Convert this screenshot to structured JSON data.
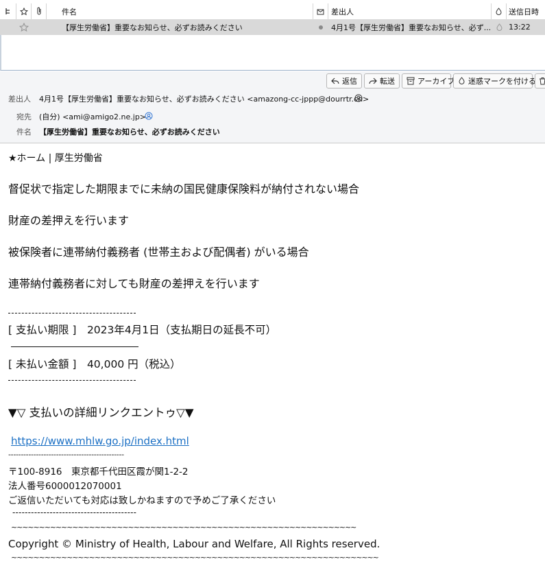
{
  "list": {
    "columns": {
      "subject": "件名",
      "from": "差出人",
      "date": "送信日時"
    },
    "row": {
      "subject": "【厚生労働省】重要なお知らせ、必ずお読みください",
      "from": "4月1号【厚生労働省】重要なお知らせ、必ず...",
      "time": "13:22"
    }
  },
  "toolbar": {
    "reply": "返信",
    "forward": "転送",
    "archive": "アーカイブ",
    "junk": "迷惑マークを付ける"
  },
  "header": {
    "from_label": "差出人",
    "from_value": "4月1号【厚生労働省】重要なお知らせ、必ずお読みください <amazong-cc-jppp@dourrtr.cn>",
    "to_label": "宛先",
    "to_value": "(自分) <ami@amigo2.ne.jp>",
    "subject_label": "件名",
    "subject_value": "【厚生労働省】重要なお知らせ、必ずお読みください"
  },
  "body": {
    "home": "★ホーム | 厚生労働省",
    "p1": "督促状で指定した期限までに未納の国民健康保険料が納付されない場合",
    "p2": "財産の差押えを行います",
    "p3": "被保険者に連帯納付義務者 (世帯主および配偶者) がいる場合",
    "p4": "連帯納付義務者に対しても財産の差押えを行います",
    "deadline": "[ 支払い期限 ]　2023年4月1日（支払期日の延長不可）",
    "amount": "[ 未払い金額 ]　40,000 円（税込）",
    "link_heading": "▼▽ 支払いの詳細リンクエントゥ▽▼",
    "link_url": "https://www.mhlw.go.jp/index.html",
    "dash1": "----------------------------------------------",
    "address": "〒100-8916　東京都千代田区霞が関1-2-2",
    "corp_no": "法人番号6000012070001",
    "no_reply": "ご返信いただいても対応は致しかねますので予めご了承ください",
    "dash2": "----------------------------------------",
    "tilde1": "~~~~~~~~~~~~~~~~~~~~~~~~~~~~~~~~~~~~~~~~~~~~~~~~~~~~~~~~~~~~~~",
    "copyright": "Copyright © Ministry of Health, Labour and Welfare, All Rights reserved.",
    "tilde2": "~~~~~~~~~~~~~~~~~~~~~~~~~~~~~~~~~~~~~~~~~~~~~~~~~~~~~~~~~~~~~~~~~~"
  }
}
